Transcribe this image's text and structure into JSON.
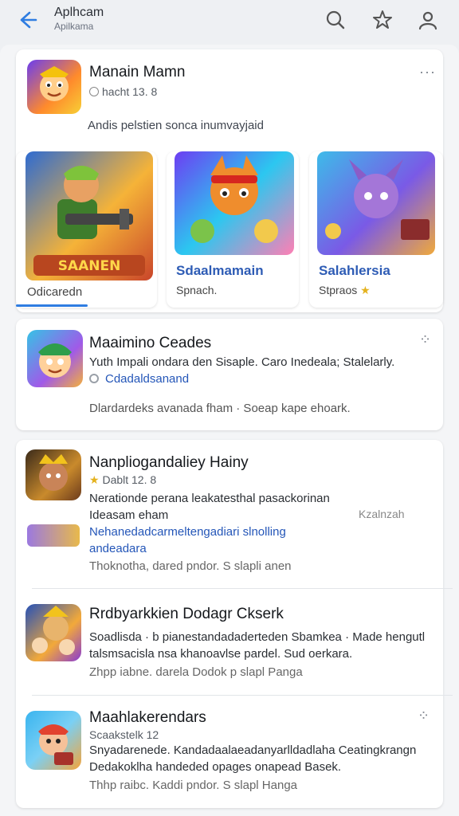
{
  "header": {
    "title": "Aplhcam",
    "subtitle": "Apilkama"
  },
  "top_card": {
    "title": "Manain Mamn",
    "meta": "hacht 13. 8",
    "description": "Andis pelstien sonca inumvayjaid",
    "tiles": [
      {
        "label": "Odicaredn",
        "sub": ""
      },
      {
        "label": "Sdaalmamain",
        "sub": "Spnach."
      },
      {
        "label": "Salahlersia",
        "sub": "Stpraos"
      }
    ]
  },
  "card2": {
    "title": "Maaimino Ceades",
    "line1": "Yuth Impali ondara den Sisaple. Caro Inedeala; Stalelarly.",
    "line2": "Cdadaldsanand",
    "line3": "Dlardardeks avanada fham · Soeap kape ehoark."
  },
  "list": [
    {
      "title": "Nanpliogandaliey Hainy",
      "meta": "Dablt 12. 8",
      "line1": "Nerationde perana leakatesthal pasackorinan",
      "line2": "Ideasam eham",
      "aside": "Kzalnzah",
      "link": "Nehanedadcarmeltengadiari slnolling",
      "link2": "andeadara",
      "foot": "Thoknotha, dared pndor. S slapli anen"
    },
    {
      "title": "Rrdbyarkkien Dodagr Ckserk",
      "line1": "Soadlisda · b pianestandadaderteden Sbamkea · Made hengutl",
      "line2": "talsmsacisla nsa khanoavlse pardel. Sud oerkara.",
      "foot": "Zhpp iabne. darela Dodok p slapl Panga"
    },
    {
      "title": "Maahlakerendars",
      "meta": "Scaakstelk 12",
      "line1": "Snyadarenede. Kandadaalaeadanyarlldadlaha Ceatingkrangn",
      "line2": "Dedakoklha handeded opages onapead Basek.",
      "foot": "Thhp raibc. Kaddi pndor. S slapl Hanga"
    }
  ]
}
